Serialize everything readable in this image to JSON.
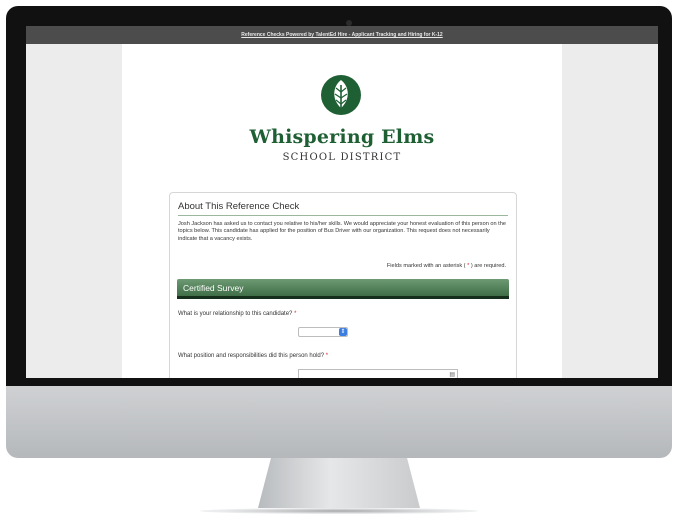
{
  "topbar": {
    "title": "Reference Checks Powered by TalentEd Hire - Applicant Tracking and Hiring for K-12"
  },
  "logo": {
    "icon": "leaf-icon",
    "title": "Whispering Elms",
    "subtitle": "SCHOOL DISTRICT",
    "color": "#1f5f34"
  },
  "about": {
    "heading": "About This Reference Check",
    "intro": "Josh Jackson has asked us to contact you relative to his/her skills. We would appreciate your honest evaluation of this person on the topics below. This candidate has applied for the position of Bus Driver with our organization. This request does not necessarily indicate that a vacancy exists.",
    "required_note_prefix": "Fields marked with an asterisk (",
    "required_star": "*",
    "required_note_suffix": ") are required."
  },
  "survey": {
    "section_title": "Certified Survey",
    "section_color": "#3f6e47",
    "q1": {
      "label": "What is your relationship to this candidate?",
      "star": "*",
      "selected": ""
    },
    "q2": {
      "label": "What position and responsibilities did this person hold?",
      "star": "*",
      "value": ""
    }
  }
}
